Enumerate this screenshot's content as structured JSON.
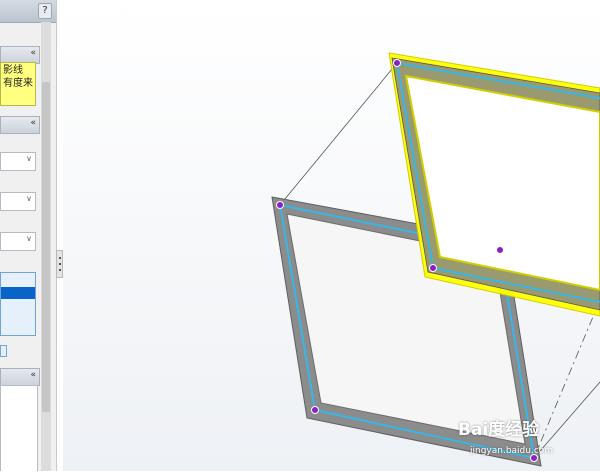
{
  "panel": {
    "help_label": "?",
    "collapse_glyph": "«",
    "message_lines": [
      "影线",
      "有度来"
    ],
    "dropdown_glyph": "∨"
  },
  "watermark": {
    "brand": "Bai度经验",
    "url": "jingyan.baidu.com"
  },
  "colors": {
    "frame_member": "#7b7b7b",
    "frame_highlight": "#ffff00",
    "sketch_line": "#37b6e8",
    "edge_line": "#555555",
    "vertex": "#8a1fc8"
  }
}
